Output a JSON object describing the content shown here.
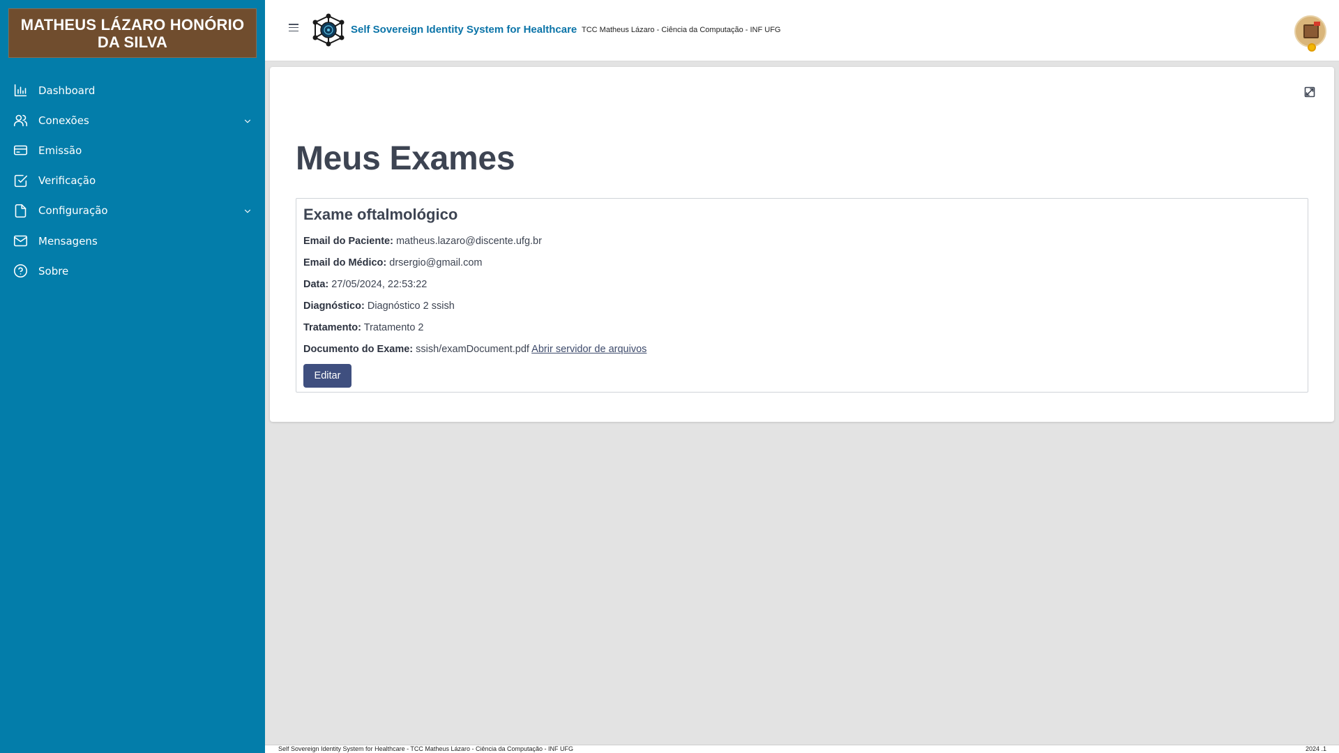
{
  "sidebar": {
    "user_name": "MATHEUS LÁZARO HONÓRIO DA SILVA",
    "background_color": "#037daa",
    "user_box_color": "#704d2e",
    "items": [
      {
        "label": "Dashboard",
        "icon": "bar-chart-icon",
        "has_submenu": false
      },
      {
        "label": "Conexões",
        "icon": "users-icon",
        "has_submenu": true
      },
      {
        "label": "Emissão",
        "icon": "credit-card-icon",
        "has_submenu": false
      },
      {
        "label": "Verificação",
        "icon": "check-square-icon",
        "has_submenu": false
      },
      {
        "label": "Configuração",
        "icon": "file-icon",
        "has_submenu": true
      },
      {
        "label": "Mensagens",
        "icon": "mail-icon",
        "has_submenu": false
      },
      {
        "label": "Sobre",
        "icon": "help-circle-icon",
        "has_submenu": false
      }
    ]
  },
  "header": {
    "app_title": "Self Sovereign Identity System for Healthcare",
    "app_subtitle": "TCC Matheus Lázaro - Ciência da Computação - INF UFG",
    "title_color": "#0b74a8"
  },
  "main": {
    "page_title": "Meus Exames",
    "exam": {
      "title": "Exame oftalmológico",
      "fields": {
        "patient_email_label": "Email do Paciente:",
        "patient_email": "matheus.lazaro@discente.ufg.br",
        "doctor_email_label": "Email do Médico:",
        "doctor_email": "drsergio@gmail.com",
        "date_label": "Data:",
        "date": "27/05/2024, 22:53:22",
        "diagnosis_label": "Diagnóstico:",
        "diagnosis": "Diagnóstico 2 ssish",
        "treatment_label": "Tratamento:",
        "treatment": "Tratamento 2",
        "document_label": "Documento do Exame:",
        "document": "ssish/examDocument.pdf",
        "document_link": "Abrir servidor de arquivos"
      },
      "edit_label": "Editar",
      "edit_color": "#3f4f7f"
    }
  },
  "footer": {
    "left": "Self Sovereign Identity System for Healthcare - TCC Matheus Lázaro - Ciência da Computação - INF UFG",
    "right": "2024 .1"
  }
}
